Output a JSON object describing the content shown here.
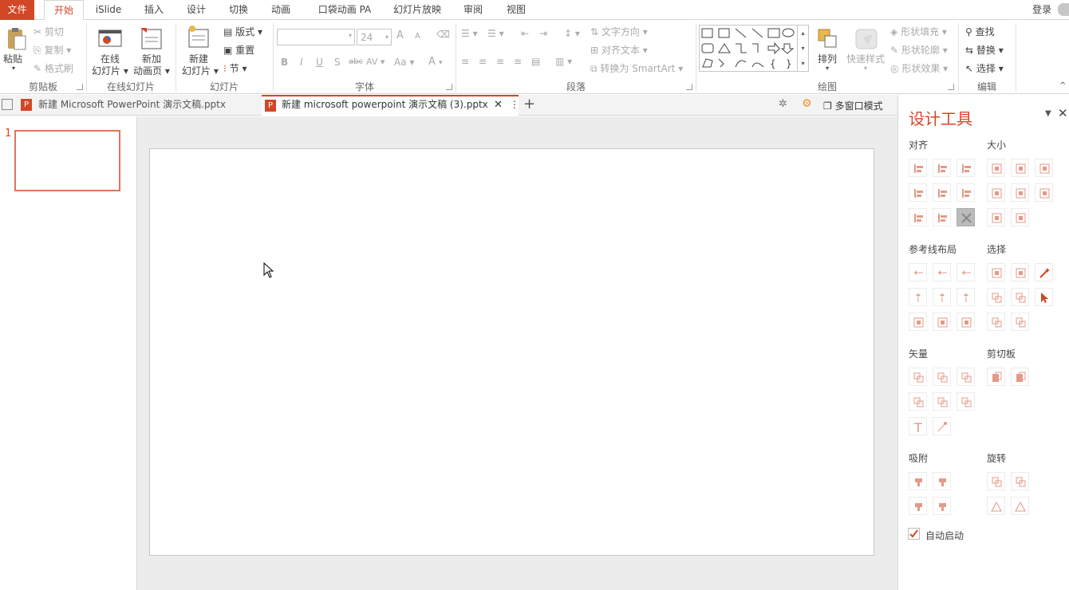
{
  "menubar": {
    "tabs": [
      "文件",
      "开始",
      "iSlide",
      "插入",
      "设计",
      "切换",
      "动画",
      "口袋动画 PA",
      "幻灯片放映",
      "审阅",
      "视图"
    ],
    "active": "开始",
    "login": "登录"
  },
  "ribbon": {
    "clipboard": {
      "paste": "粘贴",
      "cut": "剪切",
      "copy": "复制",
      "format_painter": "格式刷",
      "label": "剪贴板"
    },
    "online_slides": {
      "online_l1": "在线",
      "online_l2": "幻灯片",
      "new_anim_l1": "新加",
      "new_anim_l2": "动画页",
      "label": "在线幻灯片"
    },
    "slides": {
      "new_l1": "新建",
      "new_l2": "幻灯片",
      "layout": "版式",
      "reset": "重置",
      "section": "节",
      "label": "幻灯片"
    },
    "font": {
      "size": "24",
      "label": "字体",
      "bold": "B",
      "italic": "I",
      "underline": "U",
      "shadow": "S",
      "strike": "abc",
      "spacing": "AV",
      "case": "Aa",
      "color": "A",
      "grow": "A",
      "shrink": "A"
    },
    "paragraph": {
      "text_direction": "文字方向",
      "align_text": "对齐文本",
      "smartart": "转换为 SmartArt",
      "label": "段落"
    },
    "drawing": {
      "arrange": "排列",
      "quick_styles": "快速样式",
      "fill": "形状填充",
      "outline": "形状轮廓",
      "effects": "形状效果",
      "label": "绘图"
    },
    "editing": {
      "find": "查找",
      "replace": "替换",
      "select": "选择",
      "label": "编辑"
    }
  },
  "tabs": {
    "doc1": "新建 Microsoft PowerPoint 演示文稿.pptx",
    "doc2": "新建 microsoft powerpoint 演示文稿 (3).pptx",
    "multiwindow": "多窗口模式"
  },
  "thumbs": {
    "slide_number": "1"
  },
  "panel": {
    "title": "设计工具",
    "align": "对齐",
    "size": "大小",
    "guides": "参考线布局",
    "select": "选择",
    "vector": "矢量",
    "clipboard": "剪切板",
    "snap": "吸附",
    "rotate": "旋转",
    "auto_start": "自动启动",
    "auto_start_checked": true
  },
  "colors": {
    "accent": "#d24726",
    "panel_icon": "#e8a090"
  }
}
